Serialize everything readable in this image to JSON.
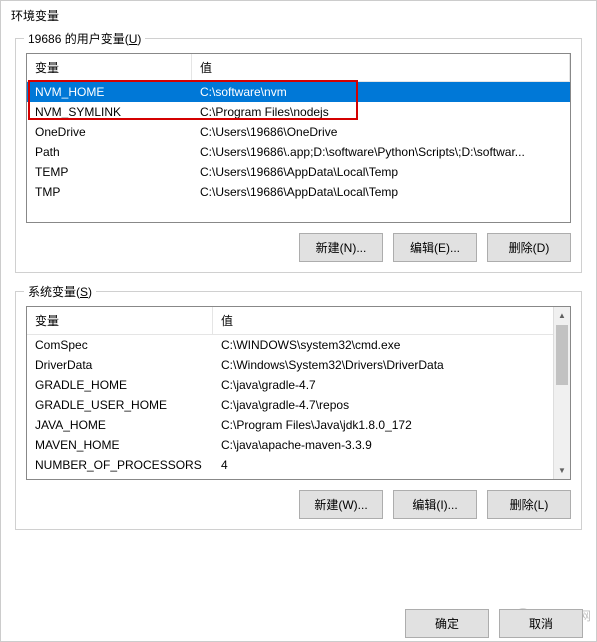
{
  "window": {
    "title": "环境变量"
  },
  "userVars": {
    "label": "19686 的用户变量",
    "hotkey": "U",
    "colVar": "变量",
    "colVal": "值",
    "rows": [
      {
        "name": "NVM_HOME",
        "value": "C:\\software\\nvm",
        "selected": true
      },
      {
        "name": "NVM_SYMLINK",
        "value": "C:\\Program Files\\nodejs",
        "selected": false
      },
      {
        "name": "OneDrive",
        "value": "C:\\Users\\19686\\OneDrive",
        "selected": false
      },
      {
        "name": "Path",
        "value": "C:\\Users\\19686\\.app;D:\\software\\Python\\Scripts\\;D:\\softwar...",
        "selected": false
      },
      {
        "name": "TEMP",
        "value": "C:\\Users\\19686\\AppData\\Local\\Temp",
        "selected": false
      },
      {
        "name": "TMP",
        "value": "C:\\Users\\19686\\AppData\\Local\\Temp",
        "selected": false
      }
    ],
    "buttons": {
      "new": "新建(N)...",
      "edit": "编辑(E)...",
      "delete": "删除(D)"
    }
  },
  "sysVars": {
    "label": "系统变量",
    "hotkey": "S",
    "colVar": "变量",
    "colVal": "值",
    "rows": [
      {
        "name": "ComSpec",
        "value": "C:\\WINDOWS\\system32\\cmd.exe"
      },
      {
        "name": "DriverData",
        "value": "C:\\Windows\\System32\\Drivers\\DriverData"
      },
      {
        "name": "GRADLE_HOME",
        "value": "C:\\java\\gradle-4.7"
      },
      {
        "name": "GRADLE_USER_HOME",
        "value": "C:\\java\\gradle-4.7\\repos"
      },
      {
        "name": "JAVA_HOME",
        "value": "C:\\Program Files\\Java\\jdk1.8.0_172"
      },
      {
        "name": "MAVEN_HOME",
        "value": "C:\\java\\apache-maven-3.3.9"
      },
      {
        "name": "NUMBER_OF_PROCESSORS",
        "value": "4"
      }
    ],
    "buttons": {
      "new": "新建(W)...",
      "edit": "编辑(I)...",
      "delete": "删除(L)"
    }
  },
  "dialog": {
    "ok": "确定",
    "cancel": "取消"
  },
  "watermark": "php中文网"
}
